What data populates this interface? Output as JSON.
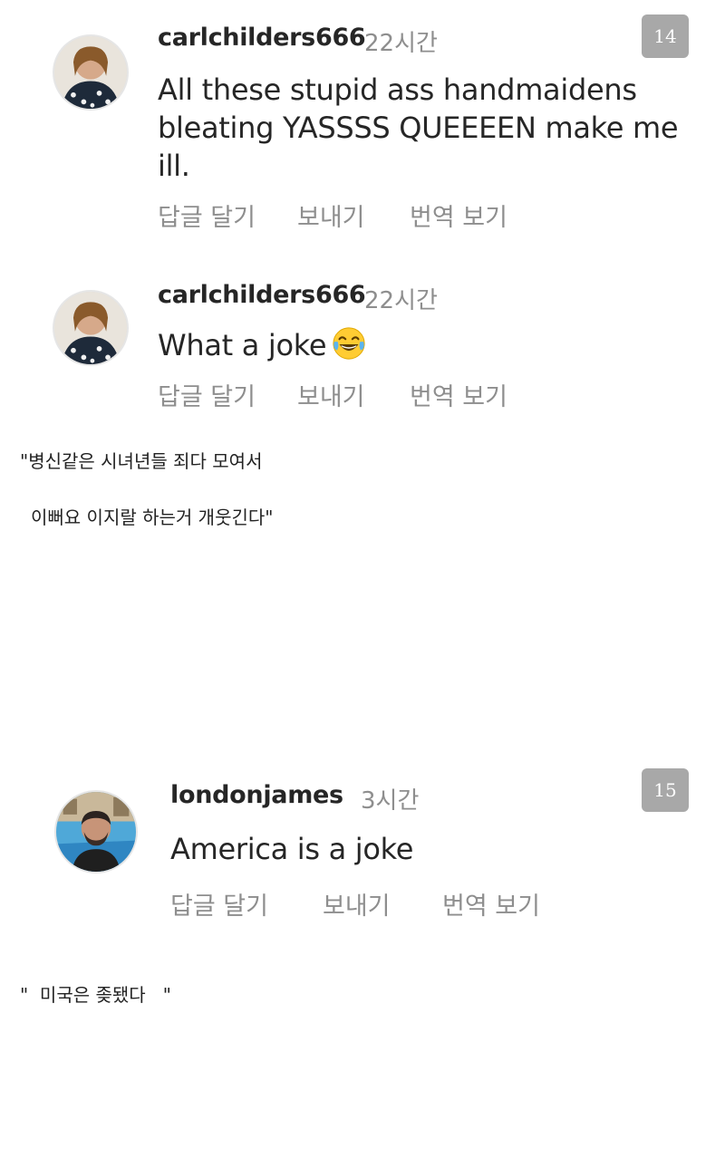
{
  "comments": [
    {
      "username": "carlchilders666",
      "time": "22시간",
      "lines": [
        "All these stupid ass handmaidens",
        "bleating YASSSS QUEEEEN make me",
        "ill."
      ],
      "actions": {
        "reply": "답글 달기",
        "send": "보내기",
        "translate": "번역 보기"
      },
      "badge": "14"
    },
    {
      "username": "carlchilders666",
      "time": "22시간",
      "text": "What a joke",
      "emoji": "laughing-tears-emoji",
      "actions": {
        "reply": "답글 달기",
        "send": "보내기",
        "translate": "번역 보기"
      }
    },
    {
      "username": "londonjames",
      "time": "3시간",
      "text": "America is a joke",
      "actions": {
        "reply": "답글 달기",
        "send": "보내기",
        "translate": "번역 보기"
      },
      "badge": "15"
    }
  ],
  "captions": {
    "first_line1": "\"병신같은 시녀년들 죄다 모여서",
    "first_line2": "이뻐요 이지랄 하는거 개웃긴다\"",
    "second": "\"  미국은 좆됐다   \""
  },
  "colors": {
    "username": "#262626",
    "meta": "#8e8e8e",
    "badge": "#a8a8a8"
  }
}
